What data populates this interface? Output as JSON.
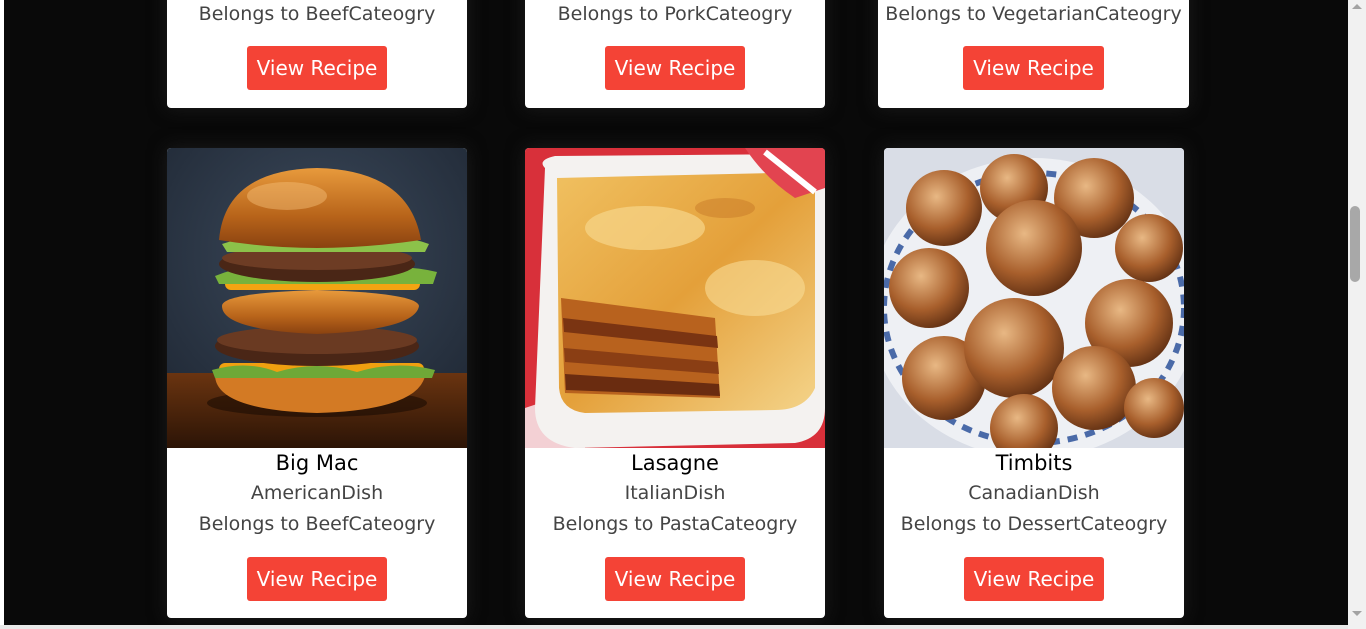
{
  "top_row": [
    {
      "belongs": "Belongs to BeefCateogry",
      "button": "View Recipe"
    },
    {
      "belongs": "Belongs to PorkCateogry",
      "button": "View Recipe"
    },
    {
      "belongs": "Belongs to VegetarianCateogry",
      "button": "View Recipe"
    }
  ],
  "bottom_row": [
    {
      "name": "Big Mac",
      "dish": "AmericanDish",
      "belongs": "Belongs to BeefCateogry",
      "button": "View Recipe",
      "image": "burger-photo"
    },
    {
      "name": "Lasagne",
      "dish": "ItalianDish",
      "belongs": "Belongs to PastaCateogry",
      "button": "View Recipe",
      "image": "lasagne-photo"
    },
    {
      "name": "Timbits",
      "dish": "CanadianDish",
      "belongs": "Belongs to DessertCateogry",
      "button": "View Recipe",
      "image": "timbits-photo"
    }
  ],
  "colors": {
    "background": "#090909",
    "card": "#ffffff",
    "button": "#f44336",
    "button_text": "#ffffff"
  }
}
